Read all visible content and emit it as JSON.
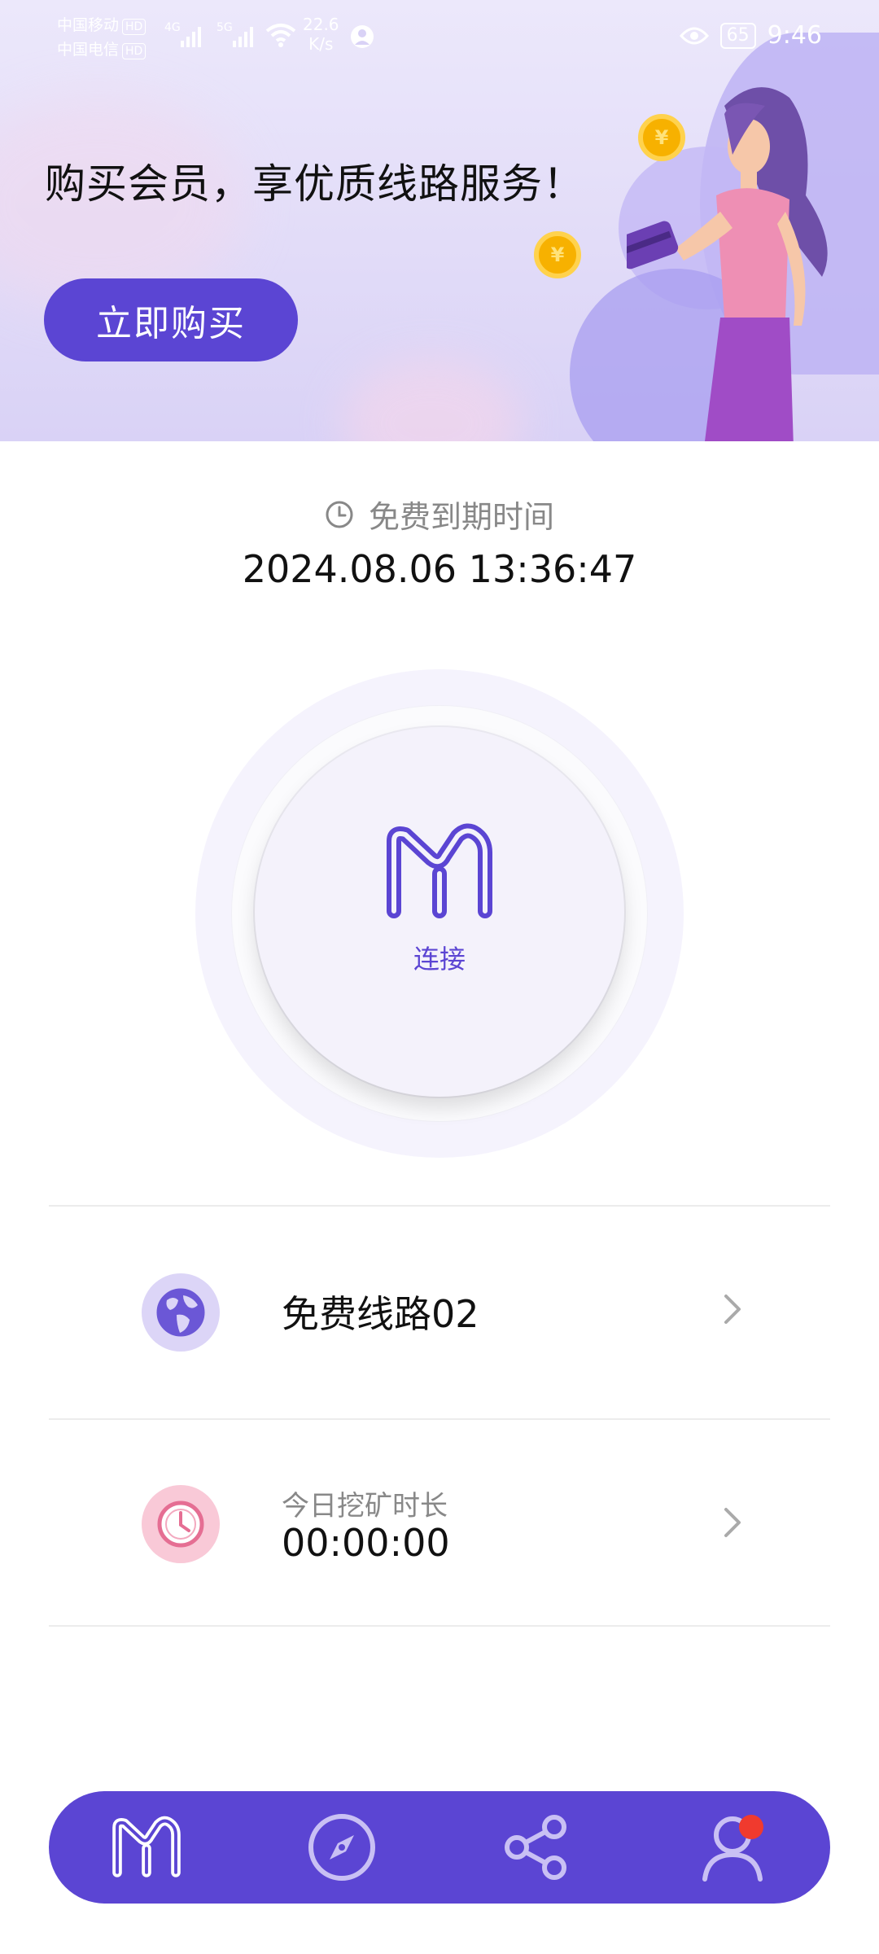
{
  "status_bar": {
    "carrier1": "中国移动",
    "carrier2": "中国电信",
    "hd": "HD",
    "sig1": "4G",
    "sig2": "5G",
    "speed_value": "22.6",
    "speed_unit": "K/s",
    "battery": "65",
    "time": "9:46"
  },
  "banner": {
    "title": "购买会员，享优质线路服务！",
    "buy_button": "立即购买"
  },
  "expiry": {
    "label": "免费到期时间",
    "time": "2024.08.06 13:36:47"
  },
  "connect": {
    "label": "连接"
  },
  "list": {
    "route": {
      "title": "免费线路02"
    },
    "mining": {
      "label": "今日挖矿时长",
      "value": "00:00:00"
    }
  },
  "bottom_nav": {
    "items": [
      "home-logo-icon",
      "compass-icon",
      "share-icon",
      "profile-icon"
    ]
  },
  "colors": {
    "accent": "#5b45d3",
    "badge": "#f03a2e"
  }
}
